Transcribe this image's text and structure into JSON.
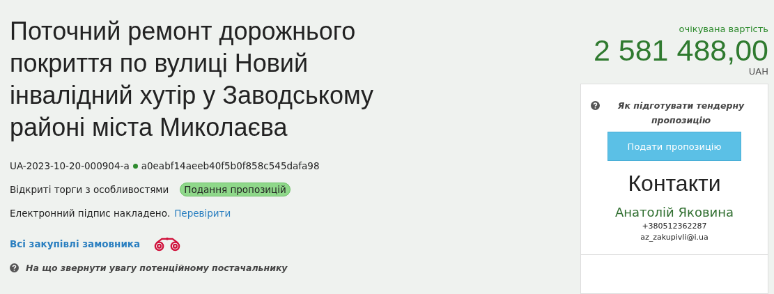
{
  "title": "Поточний ремонт дорожнього покриття по вулиці Новий інвалідний хутір у Заводському районі міста Миколаєва",
  "tender_id": "UA-2023-10-20-000904-a",
  "hash": "a0eabf14aeeb40f5b0f858c545dafa98",
  "procedure": "Відкриті торги з особливостями",
  "status_badge": {
    "label": "Подання пропозицій",
    "color": "#8fd88a"
  },
  "signature": {
    "text": "Електронний підпис накладено.",
    "link": "Перевірити"
  },
  "buyer_link": "Всі закупівлі замовника",
  "hint": "На що звернути увагу потенційному постачальнику",
  "value": {
    "caption": "очікувана вартість",
    "amount": "2 581 488,00",
    "currency": "UAH"
  },
  "card": {
    "howto": "Як підготувати тендерну пропозицію",
    "submit_button": "Подати пропозицію",
    "contacts_title": "Контакти",
    "contact_name": "Анатолій Яковина",
    "phone": "+380512362287",
    "email": "az_zakupivli@i.ua"
  }
}
